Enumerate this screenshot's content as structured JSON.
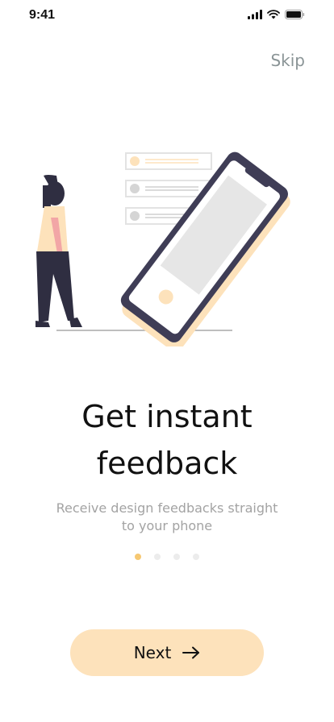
{
  "status_bar": {
    "time": "9:41",
    "icons": [
      "signal-icon",
      "wifi-icon",
      "battery-icon"
    ]
  },
  "header": {
    "skip_label": "Skip"
  },
  "illustration": {
    "description_icon": "woman-with-phone-feedback-illustration",
    "colors": {
      "accent": "#f6c872",
      "accent_light": "#fde2bb",
      "dark": "#3f3d56",
      "skin": "#f2a6a6"
    }
  },
  "content": {
    "title_line1": "Get instant",
    "title_line2": "feedback",
    "subtitle": "Receive design feedbacks straight to your phone"
  },
  "pager": {
    "count": 4,
    "active_index": 0
  },
  "footer": {
    "next_label": "Next",
    "next_icon": "arrow-right-icon"
  },
  "colors": {
    "button_bg": "#fde2bb",
    "dot_active": "#f6c872",
    "dot_inactive": "#ececec",
    "skip_text": "#8a9496"
  }
}
